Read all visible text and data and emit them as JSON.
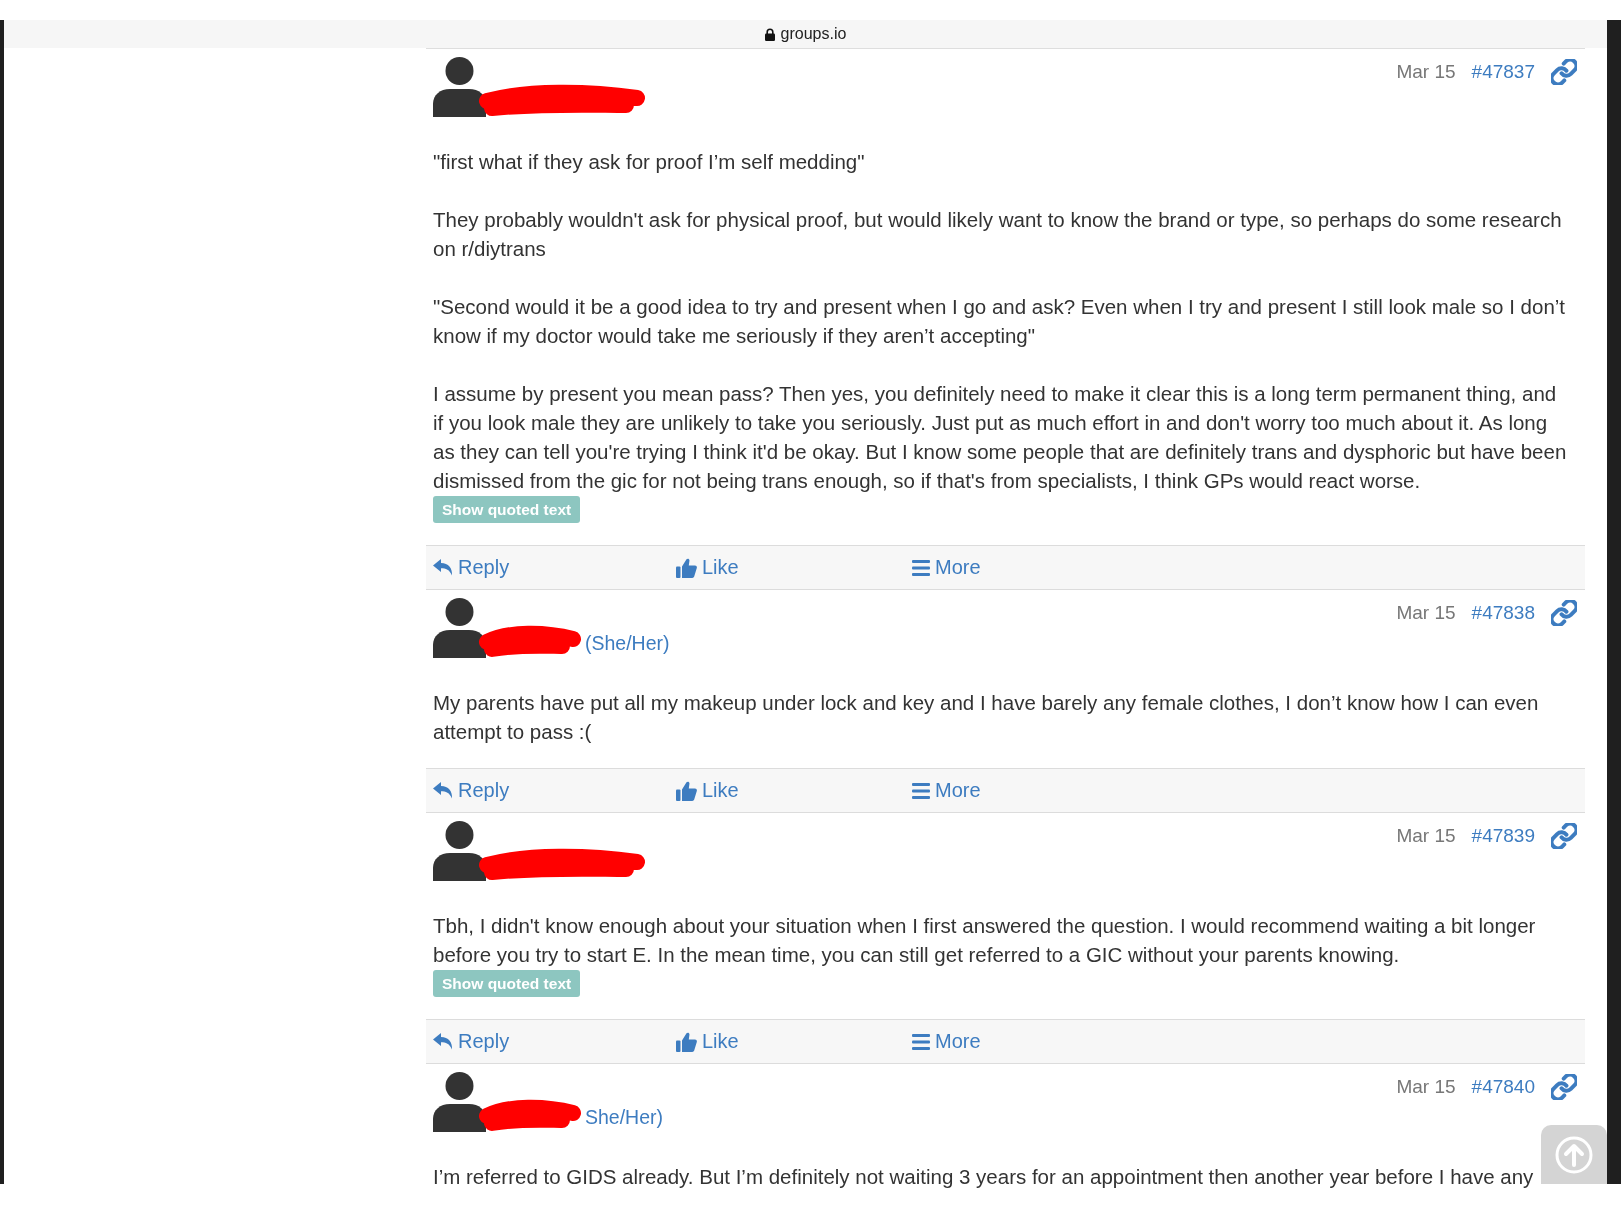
{
  "address_bar": {
    "domain": "groups.io"
  },
  "posts": [
    {
      "name_redacted": true,
      "date": "Mar 15",
      "number": "#47837",
      "body": [
        "\"first what if they ask for proof I’m self medding\"",
        "They probably wouldn't ask for physical proof, but would likely want to know the brand or type, so perhaps do some research on r/diytrans",
        "\"Second would it be a good idea to try and present when I go and ask? Even when I try and present I still look male so I don’t know if my doctor would take me seriously if they aren’t accepting\"",
        "I assume by present you mean pass? Then yes, you definitely need to make it clear this is a long term permanent thing, and if you look male they are unlikely to take you seriously. Just put as much effort in and don't worry too much about it. As long as they can tell you're trying I think it'd be okay. But I know some people that are definitely trans and dysphoric but have been dismissed from the gic for not being trans enough, so if that's from specialists, I think GPs would react worse."
      ],
      "show_quoted": "Show quoted text",
      "actions": [
        {
          "kind": "reply",
          "label": "Reply"
        },
        {
          "kind": "like",
          "label": "Like"
        },
        {
          "kind": "more",
          "label": "More"
        }
      ]
    },
    {
      "name_redacted": true,
      "pronouns": "(She/Her)",
      "date": "Mar 15",
      "number": "#47838",
      "body": [
        "My parents have put all my makeup under lock and key and I have barely any female clothes, I don’t know how I can even attempt to pass :("
      ],
      "actions": [
        {
          "kind": "reply",
          "label": "Reply"
        },
        {
          "kind": "like",
          "label": "Like"
        },
        {
          "kind": "more",
          "label": "More"
        }
      ]
    },
    {
      "name_redacted": true,
      "date": "Mar 15",
      "number": "#47839",
      "body": [
        "Tbh, I didn't know enough about your situation when I first answered the question. I would recommend waiting a bit longer before you try to start E. In the mean time, you can still get referred to a GIC without your parents knowing."
      ],
      "show_quoted": "Show quoted text",
      "actions": [
        {
          "kind": "reply",
          "label": "Reply"
        },
        {
          "kind": "like",
          "label": "Like"
        },
        {
          "kind": "more",
          "label": "More"
        }
      ]
    },
    {
      "name_redacted": true,
      "pronouns": "She/Her)",
      "date": "Mar 15",
      "number": "#47840",
      "body": [
        "I’m referred to GIDS already. But I’m definitely not waiting 3 years for an appointment then another year before I have any"
      ]
    }
  ]
}
